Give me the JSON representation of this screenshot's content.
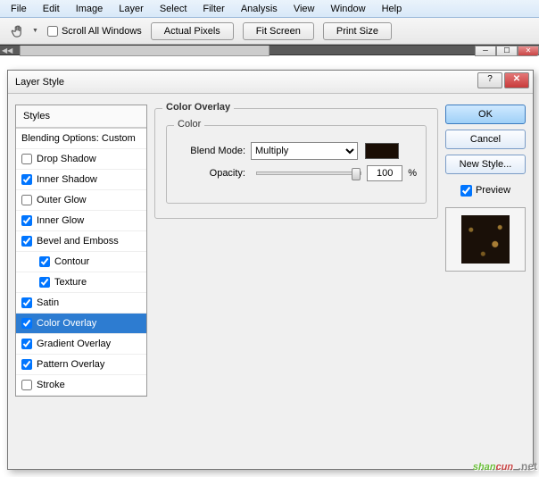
{
  "menu": {
    "items": [
      "File",
      "Edit",
      "Image",
      "Layer",
      "Select",
      "Filter",
      "Analysis",
      "View",
      "Window",
      "Help"
    ]
  },
  "toolbar": {
    "scroll_all": "Scroll All Windows",
    "actual_pixels": "Actual Pixels",
    "fit_screen": "Fit Screen",
    "print_size": "Print Size"
  },
  "dialog": {
    "title": "Layer Style",
    "styles_header": "Styles",
    "blending_label": "Blending Options: Custom",
    "effects": [
      {
        "label": "Drop Shadow",
        "checked": false,
        "indent": false,
        "selected": false
      },
      {
        "label": "Inner Shadow",
        "checked": true,
        "indent": false,
        "selected": false
      },
      {
        "label": "Outer Glow",
        "checked": false,
        "indent": false,
        "selected": false
      },
      {
        "label": "Inner Glow",
        "checked": true,
        "indent": false,
        "selected": false
      },
      {
        "label": "Bevel and Emboss",
        "checked": true,
        "indent": false,
        "selected": false
      },
      {
        "label": "Contour",
        "checked": true,
        "indent": true,
        "selected": false
      },
      {
        "label": "Texture",
        "checked": true,
        "indent": true,
        "selected": false
      },
      {
        "label": "Satin",
        "checked": true,
        "indent": false,
        "selected": false
      },
      {
        "label": "Color Overlay",
        "checked": true,
        "indent": false,
        "selected": true
      },
      {
        "label": "Gradient Overlay",
        "checked": true,
        "indent": false,
        "selected": false
      },
      {
        "label": "Pattern Overlay",
        "checked": true,
        "indent": false,
        "selected": false
      },
      {
        "label": "Stroke",
        "checked": false,
        "indent": false,
        "selected": false
      }
    ],
    "panel_title": "Color Overlay",
    "group_title": "Color",
    "blend_mode_label": "Blend Mode:",
    "blend_mode_value": "Multiply",
    "opacity_label": "Opacity:",
    "opacity_value": "100",
    "opacity_unit": "%",
    "ok": "OK",
    "cancel": "Cancel",
    "new_style": "New Style...",
    "preview": "Preview",
    "color_swatch": "#1a0e05"
  },
  "watermark": {
    "text1": "shan",
    "text2": "cun",
    "suffix": ".net"
  }
}
